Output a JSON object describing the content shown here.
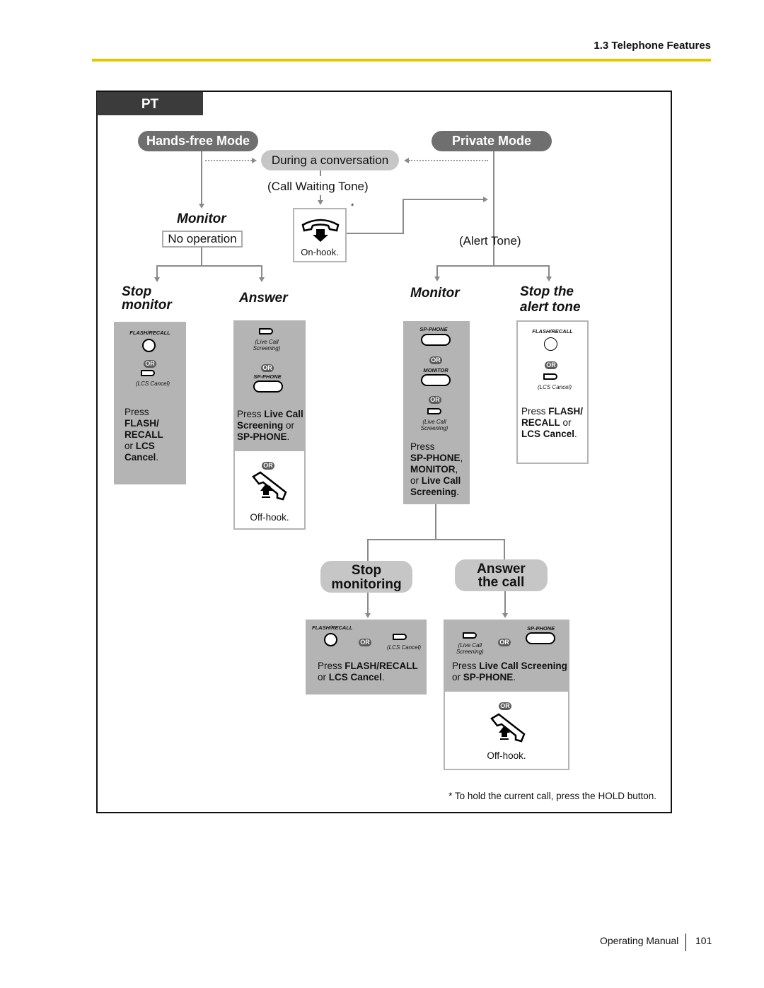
{
  "header": {
    "section": "1.3 Telephone Features"
  },
  "diagram": {
    "tab": "PT",
    "handsfree": "Hands-free Mode",
    "private": "Private Mode",
    "during": "During a conversation",
    "call_waiting": "(Call Waiting Tone)",
    "alert_tone": "(Alert Tone)",
    "asterisk": "*",
    "on_hook": "On-hook.",
    "monitor_left": "Monitor",
    "no_operation": "No operation",
    "stop_monitor": [
      "Stop",
      "monitor"
    ],
    "answer": "Answer",
    "monitor_right": "Monitor",
    "stop_alert": [
      "Stop the",
      "alert tone"
    ],
    "stop_monitoring": [
      "Stop",
      "monitoring"
    ],
    "answer_call": [
      "Answer",
      "the call"
    ],
    "off_hook": "Off-hook.",
    "or": "OR",
    "keys": {
      "flash": "FLASH/RECALL",
      "lcs": "(LCS Cancel)",
      "live1": "(Live Call",
      "live2": "Screening)",
      "sp": "SP-PHONE",
      "monitor": "MONITOR"
    },
    "desc_stop_monitor": [
      [
        "Press",
        0
      ],
      [
        "\n",
        0
      ],
      [
        "FLASH/",
        1
      ],
      [
        "\n",
        0
      ],
      [
        "RECALL",
        1
      ],
      [
        "\n",
        0
      ],
      [
        "or ",
        0
      ],
      [
        "LCS",
        1
      ],
      [
        "\n",
        0
      ],
      [
        "Cancel",
        1
      ],
      [
        ".",
        0
      ]
    ],
    "desc_answer": [
      [
        "Press ",
        0
      ],
      [
        "Live Call",
        1
      ],
      [
        "\n",
        0
      ],
      [
        "Screening",
        1
      ],
      [
        " or",
        0
      ],
      [
        "\n",
        0
      ],
      [
        "SP-PHONE",
        1
      ],
      [
        ".",
        0
      ]
    ],
    "desc_monitor": [
      [
        "Press",
        0
      ],
      [
        "\n",
        0
      ],
      [
        "SP-PHONE",
        1
      ],
      [
        ",",
        0
      ],
      [
        "\n",
        0
      ],
      [
        "MONITOR",
        1
      ],
      [
        ",",
        0
      ],
      [
        "\n",
        0
      ],
      [
        "or ",
        0
      ],
      [
        "Live Call",
        1
      ],
      [
        "\n",
        0
      ],
      [
        "Screening",
        1
      ],
      [
        ".",
        0
      ]
    ],
    "desc_stop_alert": [
      [
        "Press ",
        0
      ],
      [
        "FLASH/",
        1
      ],
      [
        "\n",
        0
      ],
      [
        "RECALL",
        1
      ],
      [
        " or",
        0
      ],
      [
        "\n",
        0
      ],
      [
        "LCS Cancel",
        1
      ],
      [
        ".",
        0
      ]
    ],
    "desc_stop_monitoring": [
      [
        "Press ",
        0
      ],
      [
        "FLASH/RECALL",
        1
      ],
      [
        "\n",
        0
      ],
      [
        "or ",
        0
      ],
      [
        "LCS Cancel",
        1
      ],
      [
        ".",
        0
      ]
    ],
    "desc_answer_call": [
      [
        "Press ",
        0
      ],
      [
        "Live Call Screening",
        1
      ],
      [
        "\n",
        0
      ],
      [
        "or ",
        0
      ],
      [
        "SP-PHONE",
        1
      ],
      [
        ".",
        0
      ]
    ],
    "footnote": "* To hold the current call, press the HOLD button."
  },
  "footer": {
    "manual": "Operating Manual",
    "page": "101"
  },
  "colors": {
    "accent_line": "#e5c700",
    "panel_gray": "#b4b4b4",
    "pill_dark": "#6f6f6f",
    "pill_light": "#c6c6c6"
  }
}
